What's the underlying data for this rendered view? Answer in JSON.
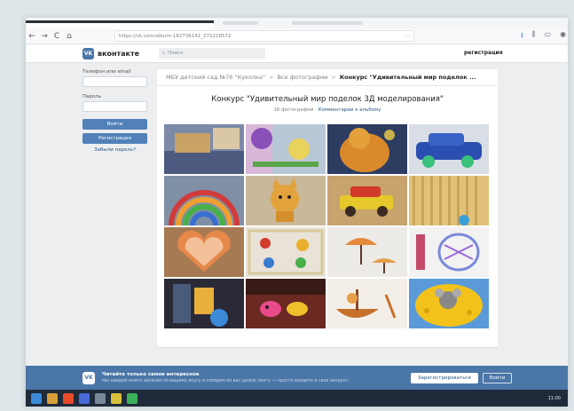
{
  "browser": {
    "url": "https://vk.com/album-182736141_272218572",
    "url_dots": "···",
    "nav_back": "←",
    "nav_forward": "→",
    "nav_reload": "C",
    "nav_home": "⌂"
  },
  "header": {
    "logo_mark": "VK",
    "logo_text": "вконтакте",
    "search_placeholder": "Поиск",
    "register_link": "регистрация"
  },
  "login": {
    "phone_label": "Телефон или email",
    "password_label": "Пароль",
    "login_button": "Войти",
    "register_button": "Регистрация",
    "forgot_link": "Забыли пароль?"
  },
  "album": {
    "breadcrumb_group": "МБУ детский сад №76 \"Куколка\"",
    "breadcrumb_all": "Все фотографии",
    "breadcrumb_current": "Конкурс \"Удивительный мир поделок ...",
    "breadcrumb_sep": ">",
    "title": "Конкурс \"Удивительный мир поделок 3Д моделирования\"",
    "photo_count": "16 фотографий",
    "meta_dot": "·",
    "comments_link": "Комментарии к альбому"
  },
  "banner": {
    "logo_mark": "VK",
    "title": "Читайте только самое интересное",
    "subtitle": "Мы найдём много записей по вашему вкусу и соберём их вас целую ленту — просто войдите в свой аккаунт.",
    "register_button": "Зарегистрироваться",
    "login_button": "Войти"
  },
  "taskbar": {
    "clock": "11:00"
  },
  "colors": {
    "vk_blue": "#4a76a8",
    "button_blue": "#5181b8",
    "link": "#2a5885"
  }
}
